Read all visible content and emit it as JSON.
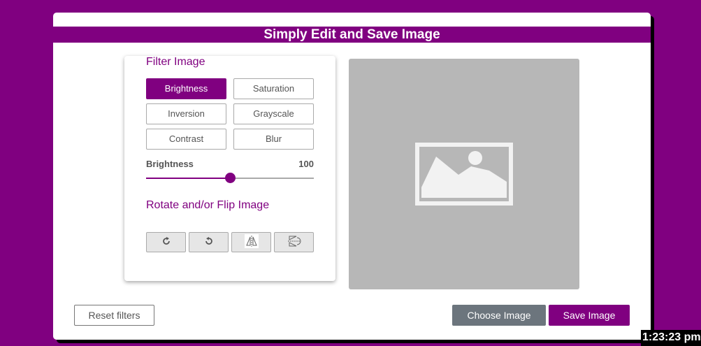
{
  "app": {
    "title": "Simply Edit and Save Image"
  },
  "filters": {
    "section_title": "Filter Image",
    "buttons": [
      {
        "label": "Brightness",
        "active": true
      },
      {
        "label": "Saturation",
        "active": false
      },
      {
        "label": "Inversion",
        "active": false
      },
      {
        "label": "Grayscale",
        "active": false
      },
      {
        "label": "Contrast",
        "active": false
      },
      {
        "label": "Blur",
        "active": false
      }
    ]
  },
  "slider": {
    "name": "Brightness",
    "value": "100",
    "fill_fraction": 0.5
  },
  "rotate": {
    "section_title": "Rotate and/or Flip Image",
    "buttons": [
      {
        "icon": "rotate-right-icon"
      },
      {
        "icon": "rotate-left-icon"
      },
      {
        "icon": "flip-horizontal-icon"
      },
      {
        "icon": "flip-vertical-icon"
      }
    ]
  },
  "preview": {
    "icon": "image-placeholder-icon"
  },
  "actions": {
    "reset_label": "Reset filters",
    "choose_label": "Choose Image",
    "save_label": "Save Image"
  },
  "clock": {
    "time": "1:23:23 pm"
  },
  "colors": {
    "accent": "#800080",
    "secondary": "#6c757d",
    "preview_bg": "#b7b7b7"
  }
}
